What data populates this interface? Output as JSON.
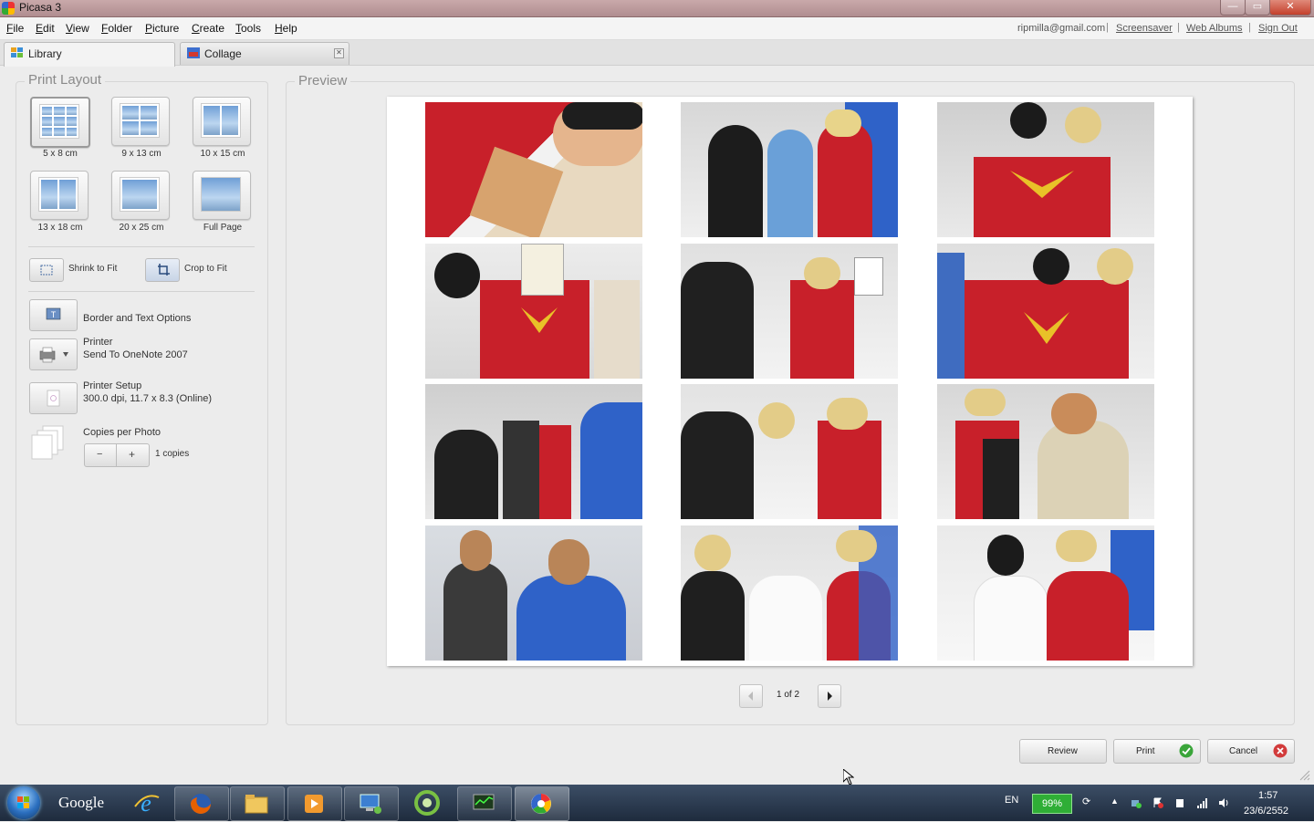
{
  "window": {
    "title": "Picasa 3"
  },
  "menu": [
    "File",
    "Edit",
    "View",
    "Folder",
    "Picture",
    "Create",
    "Tools",
    "Help"
  ],
  "menu_underline": [
    "F",
    "E",
    "V",
    "F",
    "P",
    "C",
    "T",
    "H"
  ],
  "account": {
    "email": "ripmilla@gmail.com",
    "links": [
      "Screensaver",
      "Web Albums",
      "Sign Out"
    ]
  },
  "tabs": [
    {
      "label": "Library"
    },
    {
      "label": "Collage"
    }
  ],
  "print_layout": {
    "title": "Print Layout",
    "sizes": [
      "5 x 8 cm",
      "9 x 13 cm",
      "10 x 15 cm",
      "13 x 18 cm",
      "20 x 25 cm",
      "Full Page"
    ],
    "selected": "5 x 8 cm",
    "shrink_label": "Shrink to Fit",
    "crop_label": "Crop to Fit",
    "border_text_label": "Border and Text Options",
    "printer_label": "Printer",
    "printer_name": "Send To OneNote 2007",
    "printer_setup_label": "Printer Setup",
    "printer_setup_info": "300.0 dpi, 11.7 x 8.3 (Online)",
    "copies_label": "Copies per Photo",
    "copies_minus": "−",
    "copies_plus": "+",
    "copies_value": "1 copies"
  },
  "preview": {
    "title": "Preview",
    "page_indicator": "1 of 2"
  },
  "actions": {
    "review": "Review",
    "print": "Print",
    "cancel": "Cancel"
  },
  "taskbar": {
    "google_label": "Google",
    "language": "EN",
    "battery": "99%",
    "time": "1:57",
    "date": "23/6/2552"
  },
  "colors": {
    "print_ok": "#3aa53a",
    "cancel_x": "#d23b3b",
    "photo_red": "#c8202a",
    "photo_blue": "#2f62c8"
  }
}
